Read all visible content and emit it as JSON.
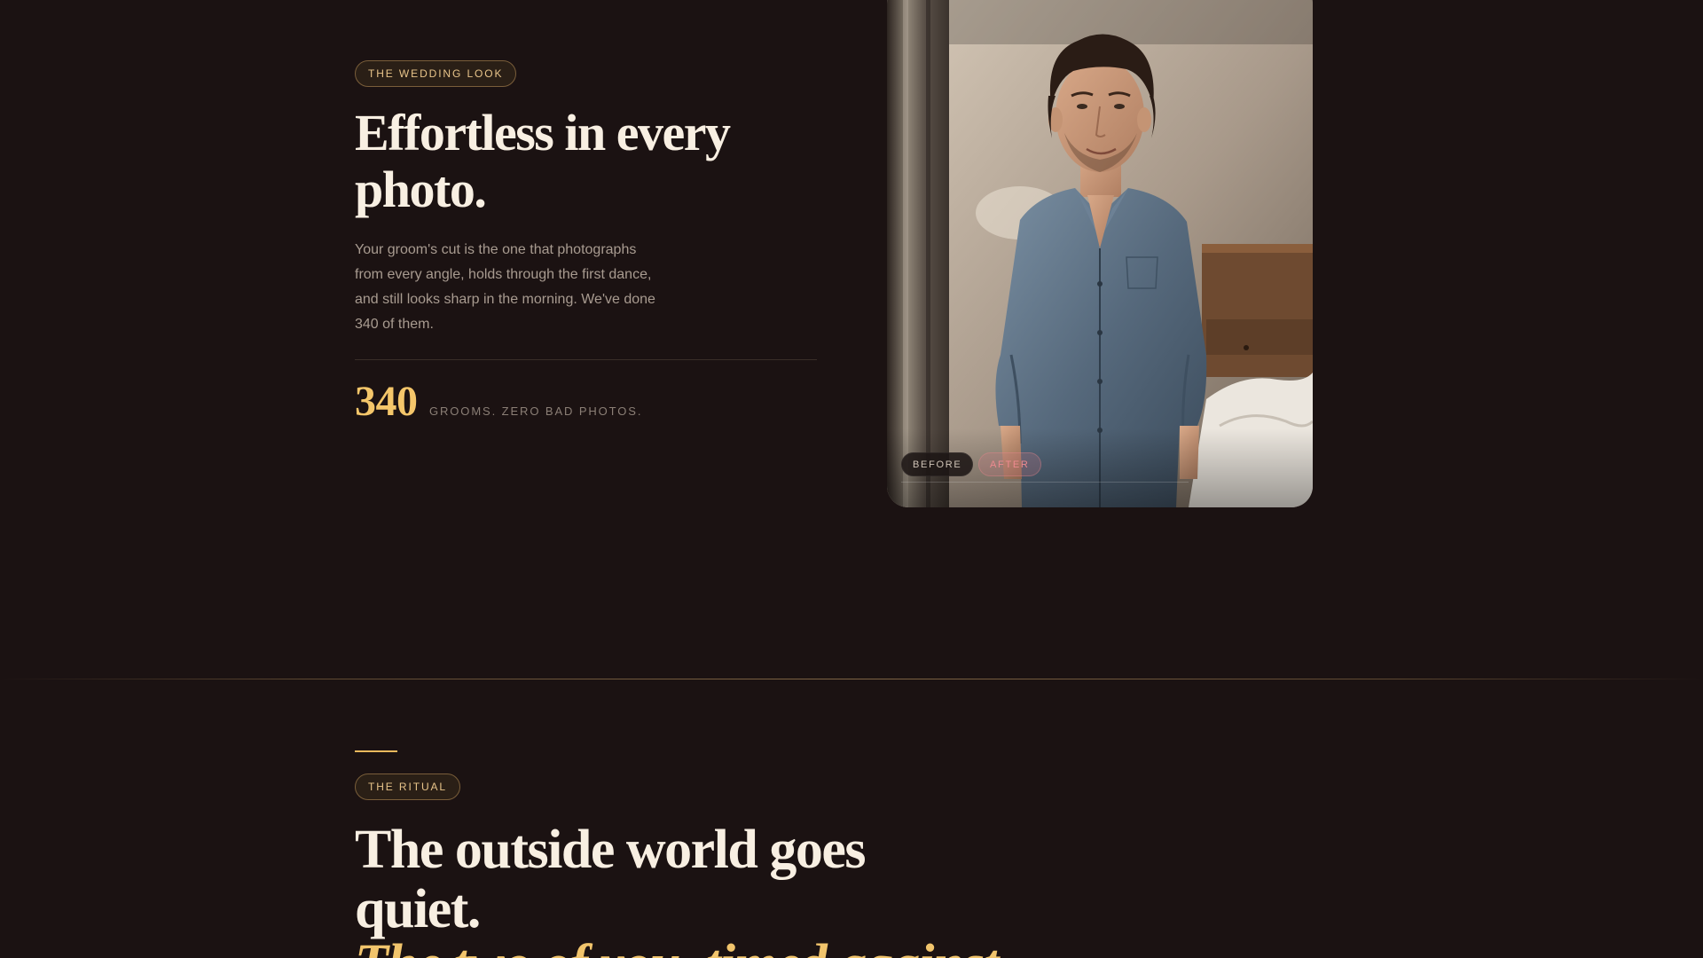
{
  "wedding_section": {
    "tag": "THE WEDDING LOOK",
    "headline": "Effortless in every photo.",
    "body": "Your groom's cut is the one that photographs from every angle, holds through the first dance, and still looks sharp in the morning. We've done 340 of them.",
    "stat_number": "340",
    "stat_label": "GROOMS. ZERO BAD PHOTOS.",
    "photo": {
      "before_label": "BEFORE",
      "after_label": "AFTER",
      "active_view": "AFTER"
    }
  },
  "ritual_section": {
    "tag": "THE RITUAL",
    "headline": "The outside world goes quiet.",
    "headline_continued": "The two of you, timed against"
  },
  "colors": {
    "background": "#1b1212",
    "accent_gold": "#f4c66a",
    "text_primary": "#f8efe2",
    "text_muted": "#a89b90",
    "after_pink": "#ee8a8f"
  }
}
